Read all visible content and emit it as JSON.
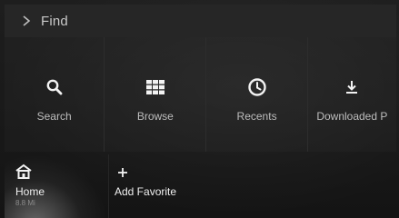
{
  "header": {
    "title": "Find"
  },
  "tiles": [
    {
      "label": "Search",
      "icon": "search-icon"
    },
    {
      "label": "Browse",
      "icon": "grid-icon"
    },
    {
      "label": "Recents",
      "icon": "clock-icon"
    },
    {
      "label": "Downloaded P",
      "icon": "download-icon"
    }
  ],
  "favorites": [
    {
      "name": "Home",
      "sub": "8.8 Mi",
      "icon": "home-icon"
    },
    {
      "name": "Add Favorite",
      "icon": "plus-icon"
    }
  ],
  "colors": {
    "background": "#161616",
    "header": "#262626",
    "text": "#bdbdbd"
  }
}
